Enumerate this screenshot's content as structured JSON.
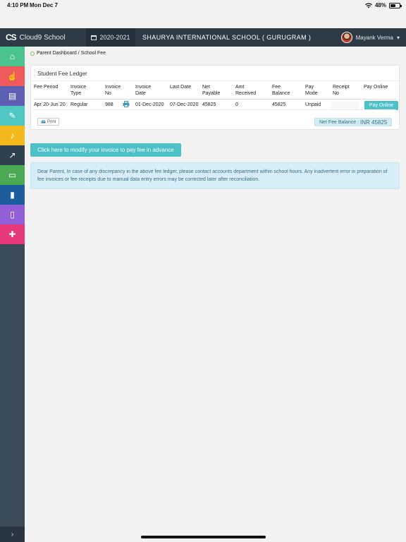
{
  "status_bar": {
    "time": "4:10 PM",
    "date": "Mon Dec 7",
    "battery": "48%"
  },
  "header": {
    "app_name": "Cloud9 School",
    "logo_text": "CS",
    "session": "2020-2021",
    "school_name": "SHAURYA INTERNATIONAL SCHOOL ( GURUGRAM )",
    "user_name": "Mayank Verma",
    "user_caret": "▾"
  },
  "sidebar": {
    "items": [
      {
        "name": "home",
        "icon": "⌂",
        "color": "#4cc490"
      },
      {
        "name": "touch",
        "icon": "☝",
        "color": "#ef5b5b"
      },
      {
        "name": "document",
        "icon": "▤",
        "color": "#5d5fb2"
      },
      {
        "name": "pin",
        "icon": "✎",
        "color": "#4fc7c3"
      },
      {
        "name": "bell",
        "icon": "♪",
        "color": "#f4b91c"
      },
      {
        "name": "chart",
        "icon": "↗",
        "color": "#30414e"
      },
      {
        "name": "card",
        "icon": "▭",
        "color": "#4caa52"
      },
      {
        "name": "book",
        "icon": "▮",
        "color": "#1e5d9c"
      },
      {
        "name": "tablet",
        "icon": "▯",
        "color": "#9160d8"
      },
      {
        "name": "plus",
        "icon": "✚",
        "color": "#e6397b"
      }
    ],
    "collapse_icon": "›"
  },
  "breadcrumb": "Parent Dashboard / School Fee",
  "ledger": {
    "title": "Student Fee Ledger",
    "headers": {
      "fee_period": "Fee Period",
      "invoice_type": [
        "Invoice",
        "Type"
      ],
      "invoice_no": [
        "Invoice",
        "No"
      ],
      "invoice_date": [
        "Invoice",
        "Date"
      ],
      "last_date": "Last Date",
      "net_payable": [
        "Net",
        "Payable"
      ],
      "amt_received": [
        "Amt",
        "Received"
      ],
      "fee_balance": [
        "Fee",
        "Balance"
      ],
      "pay_mode": [
        "Pay",
        "Mode"
      ],
      "receipt_no": [
        "Receipt",
        "No"
      ],
      "pay_online": "Pay Online"
    },
    "row": {
      "fee_period": "Apr`20-Jun`20",
      "invoice_type": "Regular",
      "invoice_no": "988",
      "invoice_date": "01-Dec-2020",
      "last_date": "07-Dec-2020",
      "net_payable": "45825",
      "amt_received": "0",
      "fee_balance": "45825",
      "pay_mode": "Unpaid",
      "receipt_no": "",
      "pay_button": "Pay Online"
    },
    "print_label": "Print",
    "net_balance_label": "Net Fee Balance :",
    "net_balance_amount": "INR 45825"
  },
  "modify_button": "Click here to modify your invoice to pay fee in advance",
  "notice": "Dear Parent, In case of any discrepancy in the above fee ledger, please contact accounts department within school hours. Any inadvertent error in preparation of fee invoices or fee receipts due to manual data entry errors may be corrected later after reconciliation."
}
